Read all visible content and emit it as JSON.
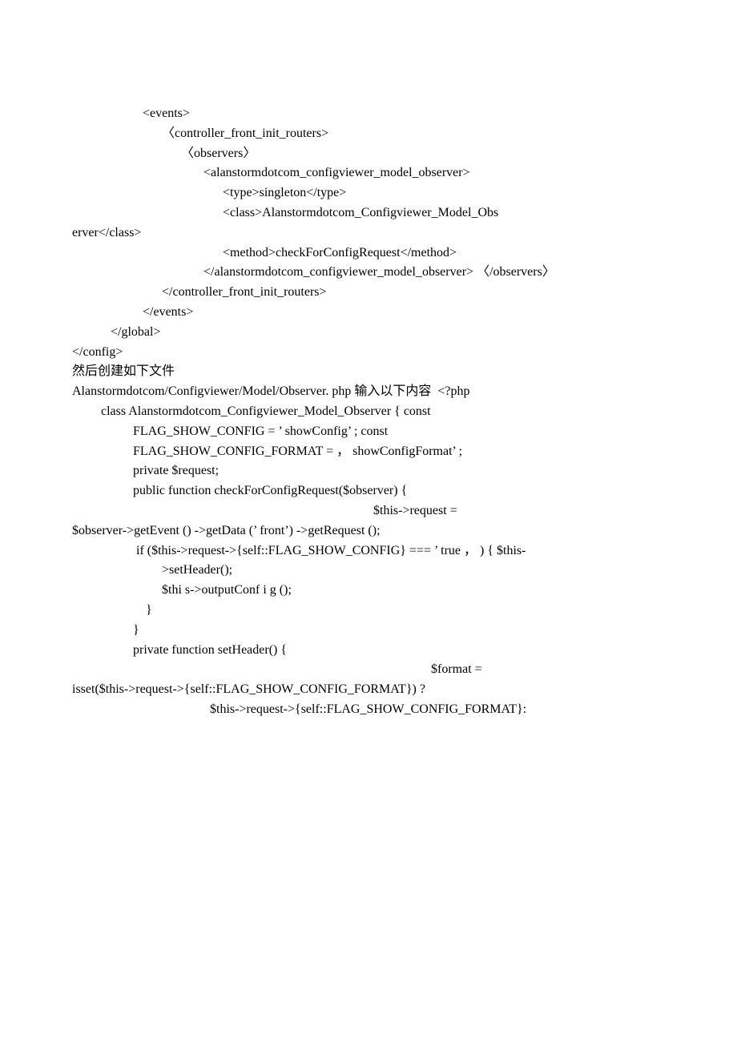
{
  "lines": [
    "                      <events>",
    "                            〈controller_front_init_routers>",
    "                                  〈observers〉",
    "                                         <alanstormdotcom_configviewer_model_observer>",
    "                                               <type>singleton</type>",
    "",
    "                                               <class>Alanstormdotcom_Configviewer_Model_Obs",
    "erver</class>",
    "                                               <method>checkForConfigRequest</method>",
    "                                         </alanstormdotcom_configviewer_model_observer> 〈/observers〉",
    "                            </controller_front_init_routers>",
    "                      </events>",
    "            </global>",
    "</config>",
    "然后创建如下文件",
    "Alanstormdotcom/Configviewer/Model/Observer. php 输入以下内容  <?php",
    "         class Alanstormdotcom_Configviewer_Model_Observer { const",
    "                   FLAG_SHOW_CONFIG = ’ showConfig’ ; const",
    "                   FLAG_SHOW_CONFIG_FORMAT = ， showConfigFormat’ ;",
    "                   private $request;",
    "                   public function checkForConfigRequest($observer) {",
    "                                                                                              $this->request =",
    "$observer->getEvent () ->getData (’ front’) ->getRequest ();",
    "                    if ($this->request->{self::FLAG_SHOW_CONFIG} === ’ true ， ) { $this-",
    "                            >setHeader();",
    "                            $thi s->outputConf i g ();",
    "                       }",
    "                   }",
    "                   private function setHeader() {",
    "                                                                                                                $format =",
    "isset($this->request->{self::FLAG_SHOW_CONFIG_FORMAT}) ?",
    "                                           $this->request->{self::FLAG_SHOW_CONFIG_FORMAT}:"
  ]
}
